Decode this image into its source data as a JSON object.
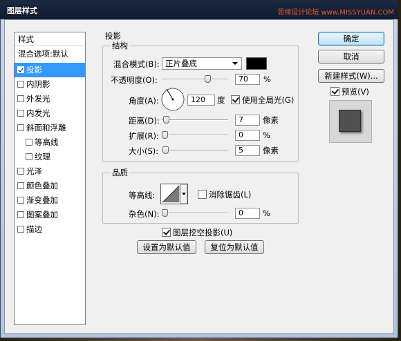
{
  "window": {
    "title": "图层样式",
    "watermark": "思缘设计论坛  www.MISSYUAN.COM"
  },
  "styles_panel": {
    "header": "样式",
    "blend_options": "混合选项:默认",
    "items": [
      {
        "label": "投影",
        "checked": true,
        "selected": true
      },
      {
        "label": "内阴影",
        "checked": false
      },
      {
        "label": "外发光",
        "checked": false
      },
      {
        "label": "内发光",
        "checked": false
      },
      {
        "label": "斜面和浮雕",
        "checked": false
      },
      {
        "label": "等高线",
        "checked": false,
        "indent": true
      },
      {
        "label": "纹理",
        "checked": false,
        "indent": true
      },
      {
        "label": "光泽",
        "checked": false
      },
      {
        "label": "颜色叠加",
        "checked": false
      },
      {
        "label": "渐变叠加",
        "checked": false
      },
      {
        "label": "图案叠加",
        "checked": false
      },
      {
        "label": "描边",
        "checked": false
      }
    ]
  },
  "shadow": {
    "section_title": "投影",
    "structure_title": "结构",
    "blend_mode_label": "混合模式(B):",
    "blend_mode_value": "正片叠底",
    "shadow_color": "#000000",
    "opacity_label": "不透明度(O):",
    "opacity_value": "70",
    "opacity_unit": "%",
    "angle_label": "角度(A):",
    "angle_value": "120",
    "angle_unit": "度",
    "global_light_label": "使用全局光(G)",
    "global_light_checked": true,
    "distance_label": "距离(D):",
    "distance_value": "7",
    "distance_unit": "像素",
    "spread_label": "扩展(R):",
    "spread_value": "0",
    "spread_unit": "%",
    "size_label": "大小(S):",
    "size_value": "5",
    "size_unit": "像素"
  },
  "quality": {
    "title": "品质",
    "contour_label": "等高线:",
    "antialias_label": "消除锯齿(L)",
    "antialias_checked": false,
    "noise_label": "杂色(N):",
    "noise_value": "0",
    "noise_unit": "%"
  },
  "knockout": {
    "label": "图层挖空投影(U)",
    "checked": true
  },
  "buttons": {
    "set_default": "设置为默认值",
    "reset_default": "复位为默认值",
    "ok": "确定",
    "cancel": "取消",
    "new_style": "新建样式(W)...",
    "preview_label": "预览(V)",
    "preview_checked": true
  },
  "colors": {
    "selection": "#3399ff",
    "preview_shape": "#505050"
  }
}
